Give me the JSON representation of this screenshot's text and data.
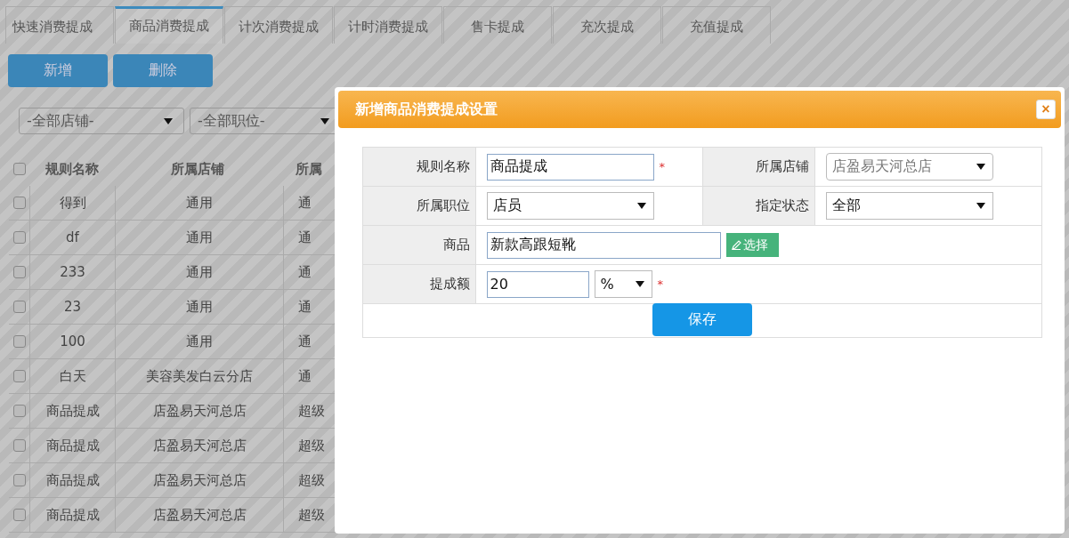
{
  "tabs": [
    {
      "label": "快速消费提成",
      "selected": false
    },
    {
      "label": "商品消费提成",
      "selected": true
    },
    {
      "label": "计次消费提成",
      "selected": false
    },
    {
      "label": "计时消费提成",
      "selected": false
    },
    {
      "label": "售卡提成",
      "selected": false
    },
    {
      "label": "充次提成",
      "selected": false
    },
    {
      "label": "充值提成",
      "selected": false
    }
  ],
  "toolbar": {
    "buttons": [
      "新增",
      "删除"
    ]
  },
  "filters": [
    {
      "value": "-全部店铺-"
    },
    {
      "value": "-全部职位-"
    }
  ],
  "table": {
    "all_checked": false,
    "columns": [
      "规则名称",
      "所属店铺",
      "所属"
    ],
    "rows": [
      {
        "checked": false,
        "cells": [
          "得到",
          "通用",
          "通"
        ]
      },
      {
        "checked": false,
        "cells": [
          "df",
          "通用",
          "通"
        ]
      },
      {
        "checked": false,
        "cells": [
          "233",
          "通用",
          "通"
        ]
      },
      {
        "checked": false,
        "cells": [
          "23",
          "通用",
          "通"
        ]
      },
      {
        "checked": false,
        "cells": [
          "100",
          "通用",
          "通"
        ]
      },
      {
        "checked": false,
        "cells": [
          "白天",
          "美容美发白云分店",
          "通"
        ]
      },
      {
        "checked": false,
        "cells": [
          "商品提成",
          "店盈易天河总店",
          "超级"
        ]
      },
      {
        "checked": false,
        "cells": [
          "商品提成",
          "店盈易天河总店",
          "超级"
        ]
      },
      {
        "checked": false,
        "cells": [
          "商品提成",
          "店盈易天河总店",
          "超级"
        ]
      },
      {
        "checked": false,
        "cells": [
          "商品提成",
          "店盈易天河总店",
          "超级"
        ]
      }
    ]
  },
  "dialog": {
    "title": "新增商品消费提成设置",
    "close": "×",
    "rows": [
      [
        {
          "kind": "text",
          "label": "规则名称",
          "value": "商品提成",
          "required_mark": "*"
        },
        {
          "kind": "select",
          "label": "所属店铺",
          "value": "店盈易天河总店",
          "disabled": true
        }
      ],
      [
        {
          "kind": "select",
          "label": "所属职位",
          "value": "店员",
          "disabled": false
        },
        {
          "kind": "select",
          "label": "指定状态",
          "value": "全部",
          "disabled": false
        }
      ],
      [
        {
          "kind": "picker",
          "label": "商品",
          "value": "新款高跟短靴",
          "button": "选择"
        }
      ],
      [
        {
          "kind": "amount",
          "label": "提成额",
          "value": "20",
          "unit": "%",
          "required_mark": "*"
        }
      ]
    ],
    "save_button": "保存"
  }
}
